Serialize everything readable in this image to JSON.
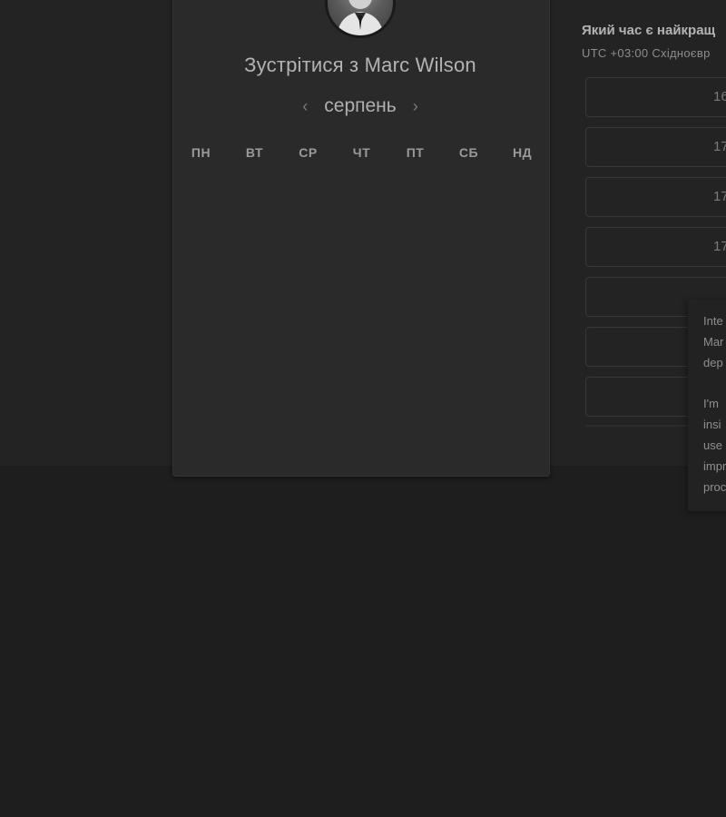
{
  "booking": {
    "title": "Зустрітися з Marc Wilson",
    "month": "серпень",
    "weekdays": [
      "ПН",
      "ВТ",
      "СР",
      "ЧТ",
      "ПТ",
      "СБ",
      "НД"
    ]
  },
  "times": {
    "question": "Який час є найкращ",
    "timezone": "UTC +03:00 Східноєвр",
    "slots": [
      "16",
      "17",
      "17",
      "17",
      "",
      "",
      ""
    ]
  },
  "popover": {
    "lines": [
      "Inte",
      "Mar",
      "dep",
      "I'm",
      "insi",
      "use",
      "impr",
      "proc"
    ]
  },
  "icons": {
    "prev": "chevron-left-icon",
    "next": "chevron-right-icon"
  },
  "colors": {
    "background": "#1e1e1f",
    "card": "#2a2a2b",
    "text": "#b3b3b3"
  }
}
